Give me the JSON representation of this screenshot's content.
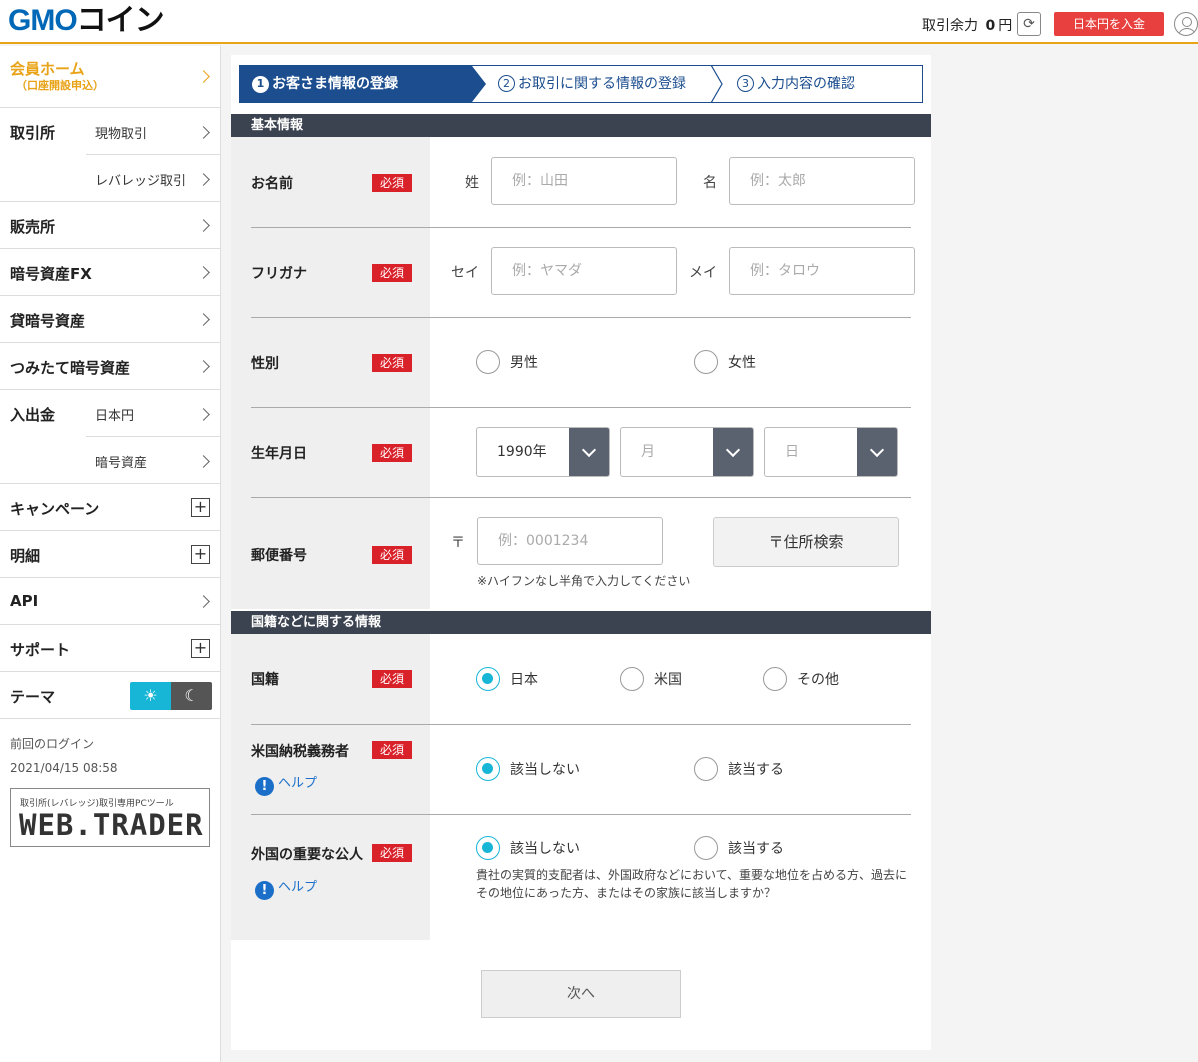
{
  "header": {
    "logo": "GMOコイン",
    "balance_label": "取引余力",
    "balance_value": "0",
    "balance_unit": "円",
    "deposit_button": "日本円を入金"
  },
  "sidebar": {
    "home": {
      "label": "会員ホーム",
      "sub": "（口座開設申込）"
    },
    "exchange": {
      "label": "取引所",
      "spot": "現物取引",
      "leverage": "レバレッジ取引"
    },
    "sales": "販売所",
    "crypto_fx": "暗号資産FX",
    "lending": "貸暗号資産",
    "tsumitate": "つみたて暗号資産",
    "deposit": {
      "label": "入出金",
      "jpy": "日本円",
      "crypto": "暗号資産"
    },
    "campaign": "キャンペーン",
    "statement": "明細",
    "api": "API",
    "support": "サポート",
    "theme": "テーマ",
    "last_login_label": "前回のログイン",
    "last_login_value": "2021/04/15 08:58",
    "webtrader_small": "取引所(レバレッジ)取引専用PCツール",
    "webtrader_big": "WEB.TRADER"
  },
  "steps": [
    {
      "num": "1",
      "label": "お客さま情報の登録"
    },
    {
      "num": "2",
      "label": "お取引に関する情報の登録"
    },
    {
      "num": "3",
      "label": "入力内容の確認"
    }
  ],
  "required": "必須",
  "basic": {
    "title": "基本情報",
    "name": {
      "label": "お名前",
      "last": "姓",
      "last_ph": "例：山田",
      "first": "名",
      "first_ph": "例：太郎"
    },
    "kana": {
      "label": "フリガナ",
      "last": "セイ",
      "last_ph": "例：ヤマダ",
      "first": "メイ",
      "first_ph": "例：タロウ"
    },
    "gender": {
      "label": "性別",
      "male": "男性",
      "female": "女性"
    },
    "birth": {
      "label": "生年月日",
      "year": "1990年",
      "month": "月",
      "day": "日"
    },
    "postal": {
      "label": "郵便番号",
      "mark": "〒",
      "ph": "例：0001234",
      "search": "〒住所検索",
      "note": "※ハイフンなし半角で入力してください"
    }
  },
  "nation": {
    "title": "国籍などに関する情報",
    "nationality": {
      "label": "国籍",
      "japan": "日本",
      "us": "米国",
      "other": "その他"
    },
    "us_tax": {
      "label": "米国納税義務者",
      "help": "ヘルプ",
      "no": "該当しない",
      "yes": "該当する"
    },
    "peps": {
      "label": "外国の重要な公人",
      "help": "ヘルプ",
      "no": "該当しない",
      "yes": "該当する",
      "note1": "貴社の実質的支配者は、外国政府などにおいて、重要な地位を占める方、過去に",
      "note2": "その地位にあった方、またはその家族に該当しますか？"
    }
  },
  "next_button": "次へ"
}
